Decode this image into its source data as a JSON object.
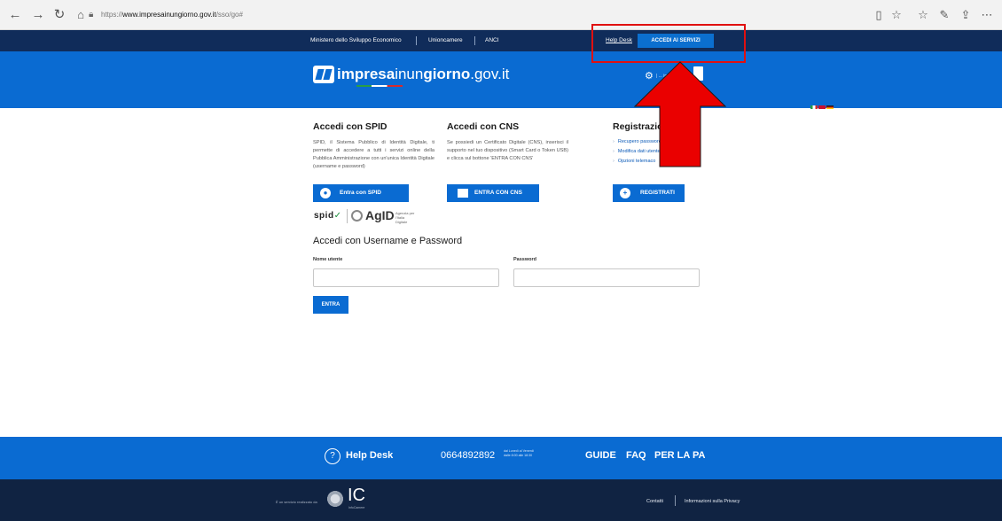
{
  "browser": {
    "url_prefix": "https://",
    "url_host": "www.impresainungiorno.gov.it",
    "url_path": "/sso/go#"
  },
  "topnav": {
    "links": [
      "Ministero dello Sviluppo Economico",
      "Unioncamere",
      "ANCI"
    ],
    "helpdesk": "Help Desk",
    "accedi": "ACCEDI AI SERVIZI"
  },
  "header": {
    "logo_bold1": "impresa",
    "logo_light": "inun",
    "logo_bold2": "giorno",
    "logo_suffix": ".gov.it",
    "gear_text": "| ... impresa"
  },
  "spid": {
    "title": "Accedi con SPID",
    "text": "SPID, il Sistema Pubblico di Identità Digitale, ti permette di accedere a tutti i servizi online della Pubblica Amministrazione con un'unica Identità Digitale (username e password)",
    "button": "Entra con SPID",
    "logo": "spid",
    "agid": "AgID",
    "agid_sub": "Agenzia per l'Italia Digitale"
  },
  "cns": {
    "title": "Accedi con CNS",
    "text": "Se possiedi un Certificato Digitale (CNS), inserisci il supporto nel tuo dispositivo (Smart Card o Token USB) e clicca sul bottone 'ENTRA CON CNS'",
    "button": "ENTRA CON CNS"
  },
  "registration": {
    "title": "Registrazione",
    "items": [
      "Recupero password",
      "Modifica dati utente",
      "Opzioni telemaco"
    ],
    "button": "REGISTRATI"
  },
  "login": {
    "title": "Accedi con Username e Password",
    "username_label": "Nome utente",
    "password_label": "Password",
    "submit": "ENTRA"
  },
  "footer": {
    "helpdesk": "Help Desk",
    "phone": "0664892892",
    "phone_sub1": "dal Lunedì al Venerdì",
    "phone_sub2": "dalle 8:00 alle 18:30",
    "links": [
      "GUIDE",
      "FAQ",
      "PER LA PA"
    ],
    "service_note": "È un servizio realizzato da",
    "ic": "IC",
    "ic_sub": "InfoCamere",
    "dark_links": [
      "Contatti",
      "Informazioni sulla Privacy"
    ]
  },
  "colors": {
    "nav_dark": "#102c5a",
    "brand_blue": "#0a6bd2",
    "footer_dark": "#102342",
    "annotation_red": "#e01010"
  }
}
